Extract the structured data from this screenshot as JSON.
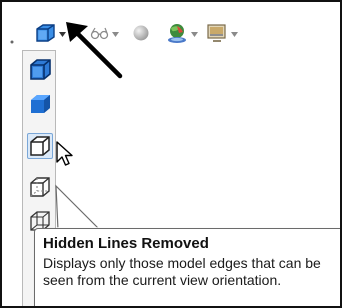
{
  "toolbar": {
    "items": [
      {
        "name": "display-style",
        "icon": "cube-display-style-icon",
        "has_dropdown": true
      },
      {
        "name": "hide-show-items",
        "icon": "glasses-icon",
        "has_dropdown": true
      },
      {
        "name": "edit-appearance",
        "icon": "sphere-appearance-icon",
        "has_dropdown": false
      },
      {
        "name": "apply-scene",
        "icon": "scene-globe-icon",
        "has_dropdown": true
      },
      {
        "name": "view-settings",
        "icon": "monitor-settings-icon",
        "has_dropdown": true
      }
    ]
  },
  "flyout": {
    "items": [
      {
        "name": "shaded-with-edges",
        "icon": "cube-shaded-edges-icon",
        "selected": false
      },
      {
        "name": "shaded",
        "icon": "cube-shaded-icon",
        "selected": false
      },
      {
        "name": "hidden-lines-removed",
        "icon": "cube-hidden-lines-removed-icon",
        "selected": true
      },
      {
        "name": "hidden-lines-visible",
        "icon": "cube-hidden-lines-visible-icon",
        "selected": false
      },
      {
        "name": "wireframe",
        "icon": "cube-wireframe-icon",
        "selected": false
      }
    ]
  },
  "tooltip": {
    "title": "Hidden Lines Removed",
    "body": "Displays only those model edges that can be seen from the current view orientation."
  },
  "colors": {
    "accent_blue": "#2e7ad6",
    "selection_fill": "#dbe9f8",
    "selection_border": "#7aa7d8",
    "tooltip_border": "#6b6b6b"
  }
}
